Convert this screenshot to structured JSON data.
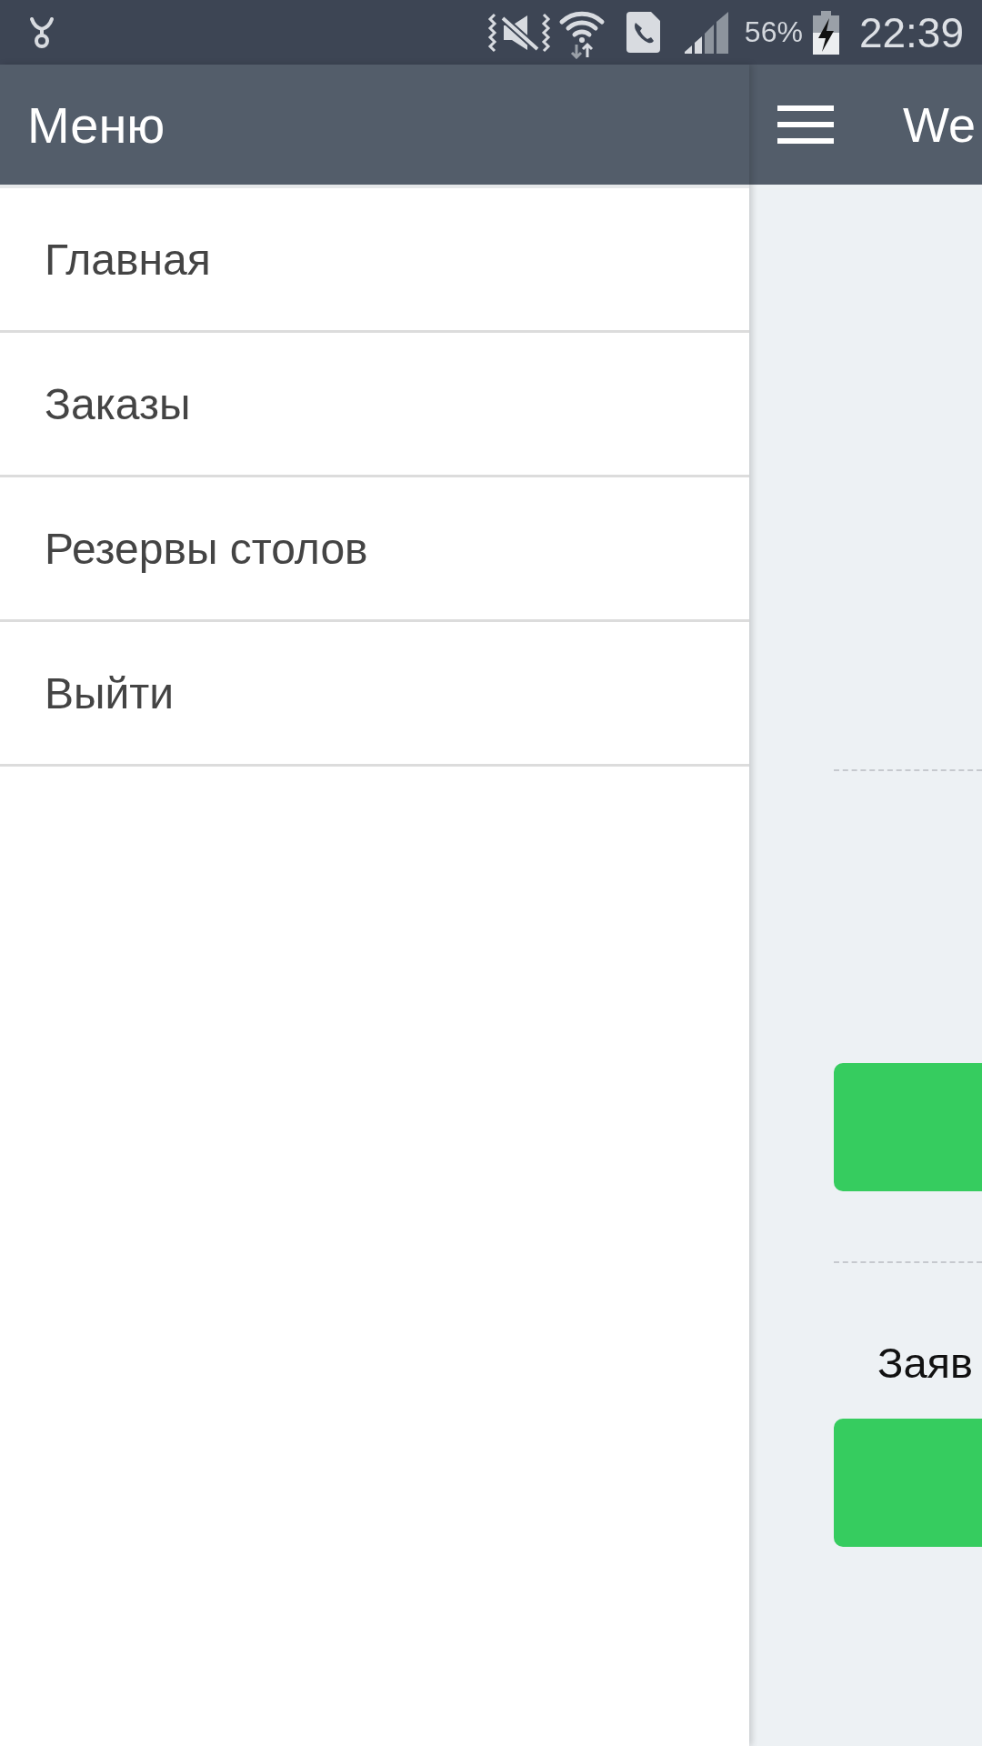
{
  "status_bar": {
    "battery_percent": "56%",
    "time": "22:39"
  },
  "drawer": {
    "title": "Меню",
    "items": [
      {
        "label": "Главная"
      },
      {
        "label": "Заказы"
      },
      {
        "label": "Резервы столов"
      },
      {
        "label": "Выйти"
      }
    ]
  },
  "main": {
    "title": "We",
    "content": [
      {
        "kind": "rule"
      },
      {
        "kind": "button"
      },
      {
        "kind": "rule"
      },
      {
        "kind": "text",
        "text": "Заяв"
      },
      {
        "kind": "button"
      }
    ]
  }
}
